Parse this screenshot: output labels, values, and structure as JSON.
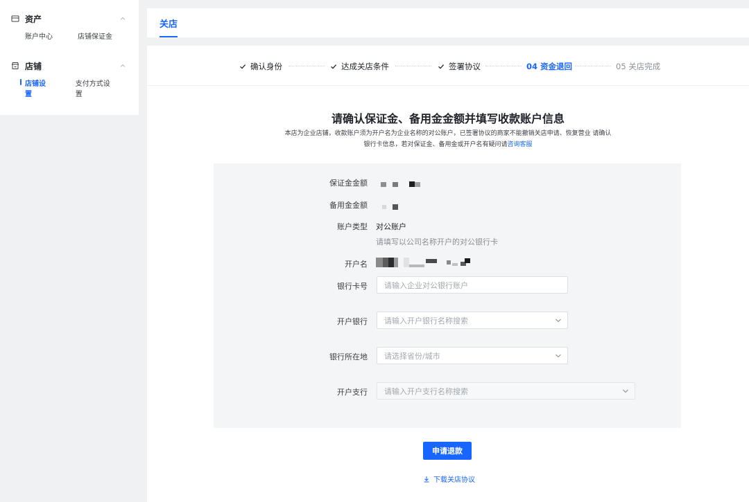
{
  "sidebar": {
    "groups": [
      {
        "title": "资产",
        "icon": "wallet-icon",
        "items": [
          {
            "label": "账户中心"
          },
          {
            "label": "店铺保证金"
          }
        ]
      },
      {
        "title": "店铺",
        "icon": "store-icon",
        "items": [
          {
            "label": "店铺设置",
            "active": true
          },
          {
            "label": "支付方式设置"
          }
        ]
      }
    ]
  },
  "header": {
    "tab": "关店"
  },
  "steps": [
    {
      "label": "确认身份",
      "status": "done"
    },
    {
      "label": "达成关店条件",
      "status": "done"
    },
    {
      "label": "签署协议",
      "status": "done"
    },
    {
      "label": "04 资金退回",
      "status": "current"
    },
    {
      "label": "05 关店完成",
      "status": "pending"
    }
  ],
  "content": {
    "title": "请确认保证金、备用金金额并填写收款账户信息",
    "desc_line1": "本店为企业店铺，收款账户须为开户名为企业名称的对公账户，已签署协议的商家不能撤销关店申请、恢复营业 请确认",
    "desc_line2_prefix": "银行卡信息，若对保证金、备用金或开户名有疑问请",
    "desc_link": "咨询客服"
  },
  "form": {
    "deposit_label": "保证金金额",
    "reserve_label": "备用金金额",
    "account_type_label": "账户类型",
    "account_type_value": "对公账户",
    "account_type_hint": "请填写以公司名称开户的对公银行卡",
    "holder_label": "开户名",
    "card_label": "银行卡号",
    "card_placeholder": "请输入企业对公银行账户",
    "bank_label": "开户银行",
    "bank_placeholder": "请输入开户银行名称搜索",
    "location_label": "银行所在地",
    "location_placeholder": "请选择省份/城市",
    "branch_label": "开户支行",
    "branch_placeholder": "请输入开户支行名称搜索"
  },
  "actions": {
    "submit": "申请退款",
    "download": "下载关店协议"
  },
  "colors": {
    "accent": "#1966ff",
    "panel": "#f4f5f6",
    "page_bg": "#f0f1f3"
  }
}
